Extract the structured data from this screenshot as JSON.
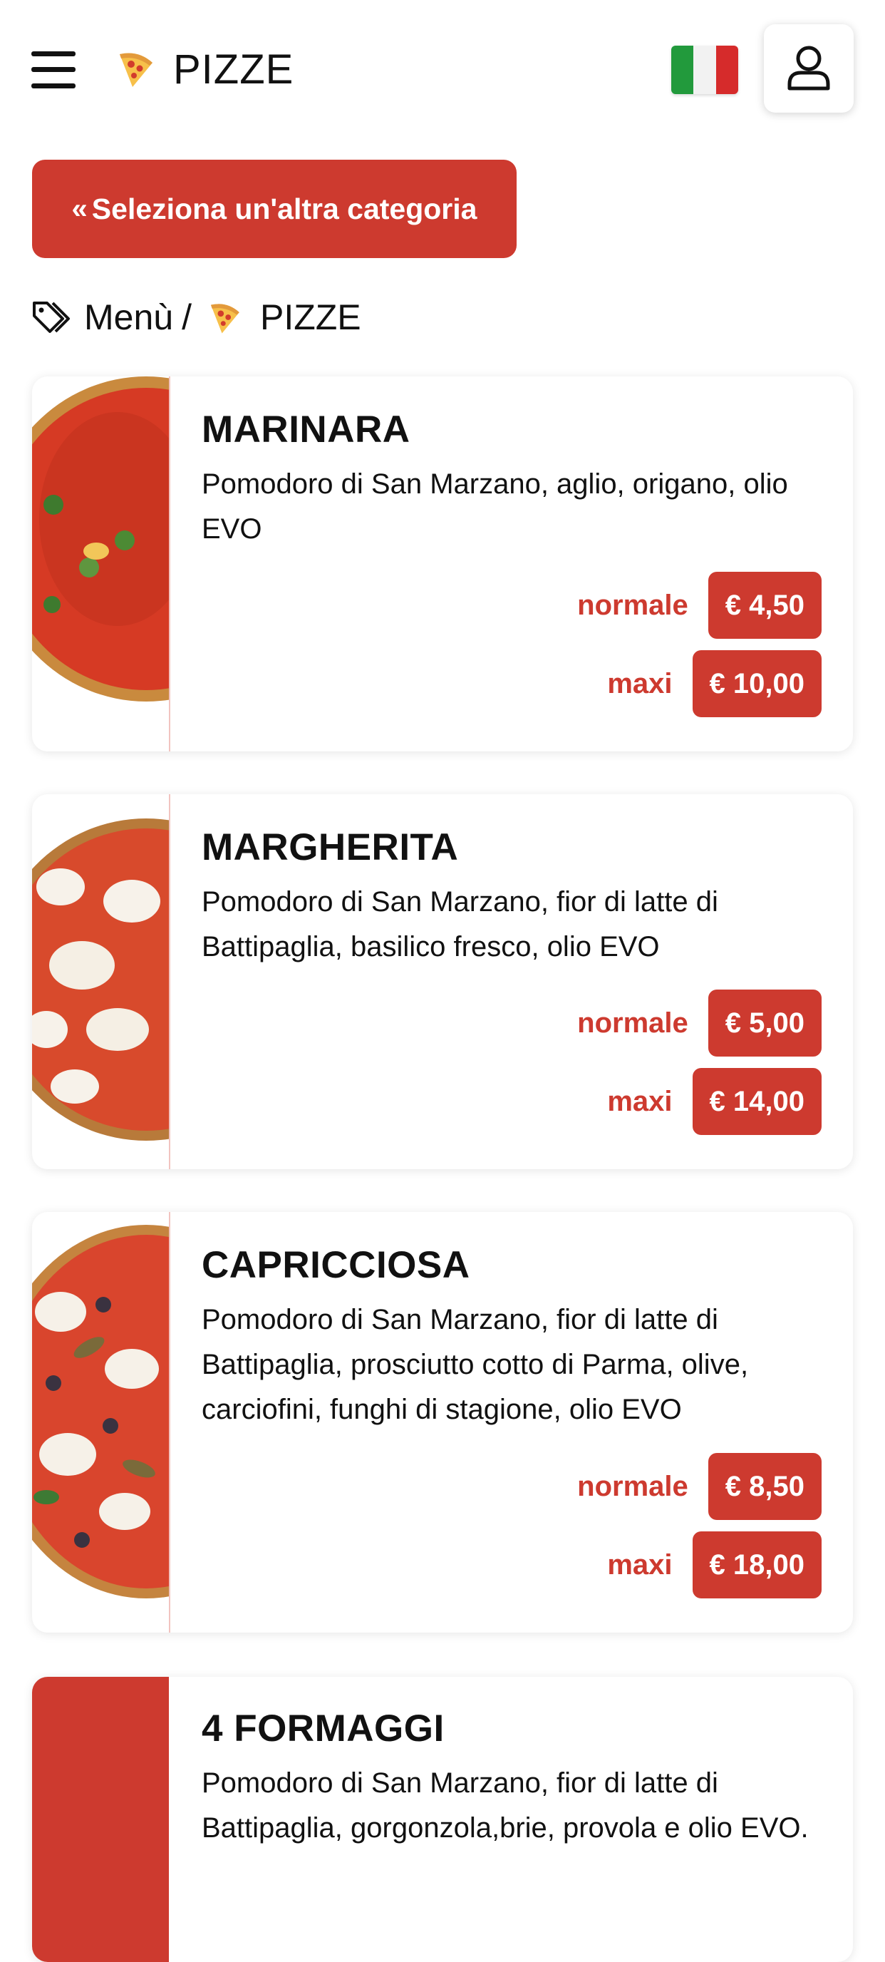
{
  "header": {
    "title": "PIZZE",
    "menu_icon": "hamburger-menu-icon",
    "category_icon": "pizza-slice-icon",
    "language_flag": "italian-flag",
    "user_icon": "user-icon"
  },
  "category_button": {
    "icon": "double-chevron-left-icon",
    "label": "Seleziona un'altra categoria"
  },
  "breadcrumb": {
    "icon": "tag-icon",
    "root": "Menù",
    "separator": "/",
    "current": "PIZZE"
  },
  "colors": {
    "accent": "#cd3a2f",
    "text": "#111111",
    "background": "#ffffff"
  },
  "products": [
    {
      "name": "MARINARA",
      "description": "Pomodoro di San Marzano, aglio, origano, olio EVO",
      "image": "pizza-marinara-photo",
      "prices": [
        {
          "size": "normale",
          "price": "€ 4,50"
        },
        {
          "size": "maxi",
          "price": "€ 10,00"
        }
      ]
    },
    {
      "name": "MARGHERITA",
      "description": "Pomodoro di San Marzano, fior di latte di Battipaglia, basilico fresco, olio EVO",
      "image": "pizza-margherita-photo",
      "prices": [
        {
          "size": "normale",
          "price": "€ 5,00"
        },
        {
          "size": "maxi",
          "price": "€ 14,00"
        }
      ]
    },
    {
      "name": "CAPRICCIOSA",
      "description": "Pomodoro di San Marzano, fior di latte di Battipaglia, prosciutto cotto di Parma, olive, carciofini, funghi di stagione, olio EVO",
      "image": "pizza-capricciosa-photo",
      "prices": [
        {
          "size": "normale",
          "price": "€ 8,50"
        },
        {
          "size": "maxi",
          "price": "€ 18,00"
        }
      ]
    },
    {
      "name": "4 FORMAGGI",
      "description": "Pomodoro di San Marzano, fior di latte di Battipaglia, gorgonzola,brie, provola e olio EVO.",
      "image": "placeholder-red-block",
      "prices": []
    }
  ]
}
